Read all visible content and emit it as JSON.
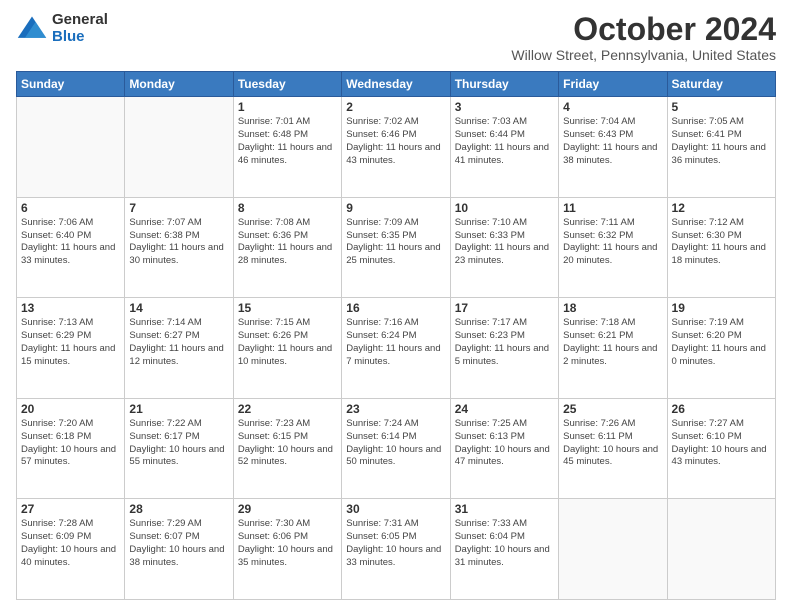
{
  "logo": {
    "general": "General",
    "blue": "Blue"
  },
  "header": {
    "month": "October 2024",
    "location": "Willow Street, Pennsylvania, United States"
  },
  "weekdays": [
    "Sunday",
    "Monday",
    "Tuesday",
    "Wednesday",
    "Thursday",
    "Friday",
    "Saturday"
  ],
  "weeks": [
    [
      {
        "day": "",
        "info": ""
      },
      {
        "day": "",
        "info": ""
      },
      {
        "day": "1",
        "info": "Sunrise: 7:01 AM\nSunset: 6:48 PM\nDaylight: 11 hours and 46 minutes."
      },
      {
        "day": "2",
        "info": "Sunrise: 7:02 AM\nSunset: 6:46 PM\nDaylight: 11 hours and 43 minutes."
      },
      {
        "day": "3",
        "info": "Sunrise: 7:03 AM\nSunset: 6:44 PM\nDaylight: 11 hours and 41 minutes."
      },
      {
        "day": "4",
        "info": "Sunrise: 7:04 AM\nSunset: 6:43 PM\nDaylight: 11 hours and 38 minutes."
      },
      {
        "day": "5",
        "info": "Sunrise: 7:05 AM\nSunset: 6:41 PM\nDaylight: 11 hours and 36 minutes."
      }
    ],
    [
      {
        "day": "6",
        "info": "Sunrise: 7:06 AM\nSunset: 6:40 PM\nDaylight: 11 hours and 33 minutes."
      },
      {
        "day": "7",
        "info": "Sunrise: 7:07 AM\nSunset: 6:38 PM\nDaylight: 11 hours and 30 minutes."
      },
      {
        "day": "8",
        "info": "Sunrise: 7:08 AM\nSunset: 6:36 PM\nDaylight: 11 hours and 28 minutes."
      },
      {
        "day": "9",
        "info": "Sunrise: 7:09 AM\nSunset: 6:35 PM\nDaylight: 11 hours and 25 minutes."
      },
      {
        "day": "10",
        "info": "Sunrise: 7:10 AM\nSunset: 6:33 PM\nDaylight: 11 hours and 23 minutes."
      },
      {
        "day": "11",
        "info": "Sunrise: 7:11 AM\nSunset: 6:32 PM\nDaylight: 11 hours and 20 minutes."
      },
      {
        "day": "12",
        "info": "Sunrise: 7:12 AM\nSunset: 6:30 PM\nDaylight: 11 hours and 18 minutes."
      }
    ],
    [
      {
        "day": "13",
        "info": "Sunrise: 7:13 AM\nSunset: 6:29 PM\nDaylight: 11 hours and 15 minutes."
      },
      {
        "day": "14",
        "info": "Sunrise: 7:14 AM\nSunset: 6:27 PM\nDaylight: 11 hours and 12 minutes."
      },
      {
        "day": "15",
        "info": "Sunrise: 7:15 AM\nSunset: 6:26 PM\nDaylight: 11 hours and 10 minutes."
      },
      {
        "day": "16",
        "info": "Sunrise: 7:16 AM\nSunset: 6:24 PM\nDaylight: 11 hours and 7 minutes."
      },
      {
        "day": "17",
        "info": "Sunrise: 7:17 AM\nSunset: 6:23 PM\nDaylight: 11 hours and 5 minutes."
      },
      {
        "day": "18",
        "info": "Sunrise: 7:18 AM\nSunset: 6:21 PM\nDaylight: 11 hours and 2 minutes."
      },
      {
        "day": "19",
        "info": "Sunrise: 7:19 AM\nSunset: 6:20 PM\nDaylight: 11 hours and 0 minutes."
      }
    ],
    [
      {
        "day": "20",
        "info": "Sunrise: 7:20 AM\nSunset: 6:18 PM\nDaylight: 10 hours and 57 minutes."
      },
      {
        "day": "21",
        "info": "Sunrise: 7:22 AM\nSunset: 6:17 PM\nDaylight: 10 hours and 55 minutes."
      },
      {
        "day": "22",
        "info": "Sunrise: 7:23 AM\nSunset: 6:15 PM\nDaylight: 10 hours and 52 minutes."
      },
      {
        "day": "23",
        "info": "Sunrise: 7:24 AM\nSunset: 6:14 PM\nDaylight: 10 hours and 50 minutes."
      },
      {
        "day": "24",
        "info": "Sunrise: 7:25 AM\nSunset: 6:13 PM\nDaylight: 10 hours and 47 minutes."
      },
      {
        "day": "25",
        "info": "Sunrise: 7:26 AM\nSunset: 6:11 PM\nDaylight: 10 hours and 45 minutes."
      },
      {
        "day": "26",
        "info": "Sunrise: 7:27 AM\nSunset: 6:10 PM\nDaylight: 10 hours and 43 minutes."
      }
    ],
    [
      {
        "day": "27",
        "info": "Sunrise: 7:28 AM\nSunset: 6:09 PM\nDaylight: 10 hours and 40 minutes."
      },
      {
        "day": "28",
        "info": "Sunrise: 7:29 AM\nSunset: 6:07 PM\nDaylight: 10 hours and 38 minutes."
      },
      {
        "day": "29",
        "info": "Sunrise: 7:30 AM\nSunset: 6:06 PM\nDaylight: 10 hours and 35 minutes."
      },
      {
        "day": "30",
        "info": "Sunrise: 7:31 AM\nSunset: 6:05 PM\nDaylight: 10 hours and 33 minutes."
      },
      {
        "day": "31",
        "info": "Sunrise: 7:33 AM\nSunset: 6:04 PM\nDaylight: 10 hours and 31 minutes."
      },
      {
        "day": "",
        "info": ""
      },
      {
        "day": "",
        "info": ""
      }
    ]
  ]
}
